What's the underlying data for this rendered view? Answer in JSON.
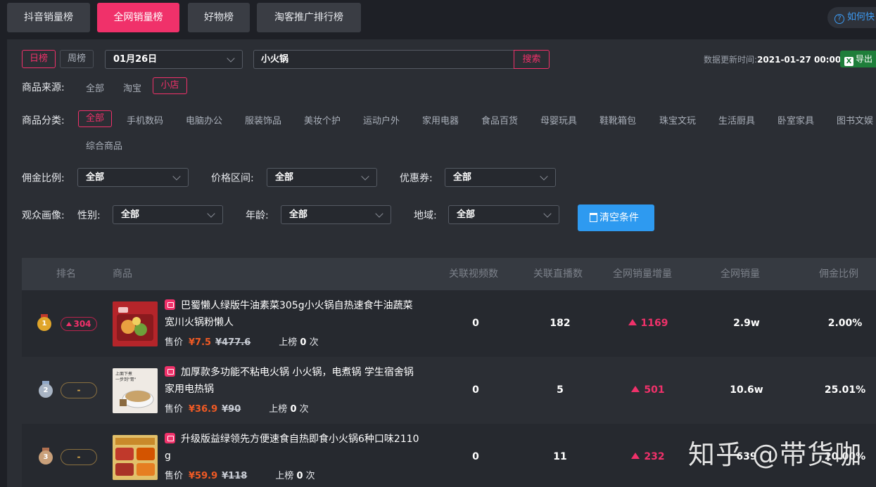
{
  "top_tabs": [
    "抖音销量榜",
    "全网销量榜",
    "好物榜",
    "淘客推广排行榜"
  ],
  "howto": "如何快",
  "period": {
    "daily": "日榜",
    "weekly": "周榜"
  },
  "date_select": "01月26日",
  "search": {
    "value": "小火锅",
    "button": "搜索"
  },
  "update": {
    "label": "数据更新时间:",
    "time": "2021-01-27 00:00"
  },
  "export": "导出",
  "source": {
    "label": "商品来源:",
    "options": [
      "全部",
      "淘宝",
      "小店"
    ]
  },
  "category": {
    "label": "商品分类:",
    "options": [
      "全部",
      "手机数码",
      "电脑办公",
      "服装饰品",
      "美妆个护",
      "运动户外",
      "家用电器",
      "食品百货",
      "母婴玩具",
      "鞋靴箱包",
      "珠宝文玩",
      "生活厨具",
      "卧室家具",
      "图书文娱",
      "综合商品"
    ]
  },
  "filters": {
    "commission": {
      "label": "佣金比例:",
      "value": "全部"
    },
    "price": {
      "label": "价格区间:",
      "value": "全部"
    },
    "coupon": {
      "label": "优惠券:",
      "value": "全部"
    }
  },
  "audience": {
    "label": "观众画像:",
    "gender": {
      "label": "性别:",
      "value": "全部"
    },
    "age": {
      "label": "年龄:",
      "value": "全部"
    },
    "region": {
      "label": "地域:",
      "value": "全部"
    }
  },
  "clear_button": "清空条件",
  "table": {
    "headers": [
      "排名",
      "商品",
      "关联视频数",
      "关联直播数",
      "全网销量增量",
      "全网销量",
      "佣金比例"
    ],
    "rows": [
      {
        "medal": "1",
        "rank_change": "304",
        "name_line1": "巴蜀懒人绿版牛油素菜305g小火锅自热速食牛油蔬菜",
        "name_line2": "宽川火锅粉懒人",
        "price_label": "售价",
        "price_now": "¥7.5",
        "price_old": "¥477.6",
        "rank_label": "上榜",
        "rank_times": "0",
        "rank_unit": "次",
        "videos": "0",
        "lives": "182",
        "increase": "1169",
        "sales": "2.9w",
        "commission": "2.00%"
      },
      {
        "medal": "2",
        "rank_change": "-",
        "name_line1": "加厚款多功能不粘电火锅 小火锅，电煮锅 学生宿舍锅",
        "name_line2": "家用电热锅",
        "price_label": "售价",
        "price_now": "¥36.9",
        "price_old": "¥90",
        "rank_label": "上榜",
        "rank_times": "0",
        "rank_unit": "次",
        "videos": "0",
        "lives": "5",
        "increase": "501",
        "sales": "10.6w",
        "commission": "25.01%"
      },
      {
        "medal": "3",
        "rank_change": "-",
        "name_line1": "升级版益绿领先方便速食自热即食小火锅6种口味2110",
        "name_line2": "g",
        "price_label": "售价",
        "price_now": "¥59.9",
        "price_old": "¥118",
        "rank_label": "上榜",
        "rank_times": "0",
        "rank_unit": "次",
        "videos": "0",
        "lives": "11",
        "increase": "232",
        "sales": "639",
        "commission": "20.00%"
      }
    ]
  },
  "watermark": "知乎 @带货咖",
  "colors": {
    "accent": "#f0316a",
    "primary_button": "#2e9af0",
    "export_green": "#1e7e3a",
    "price_orange": "#f15a24"
  }
}
